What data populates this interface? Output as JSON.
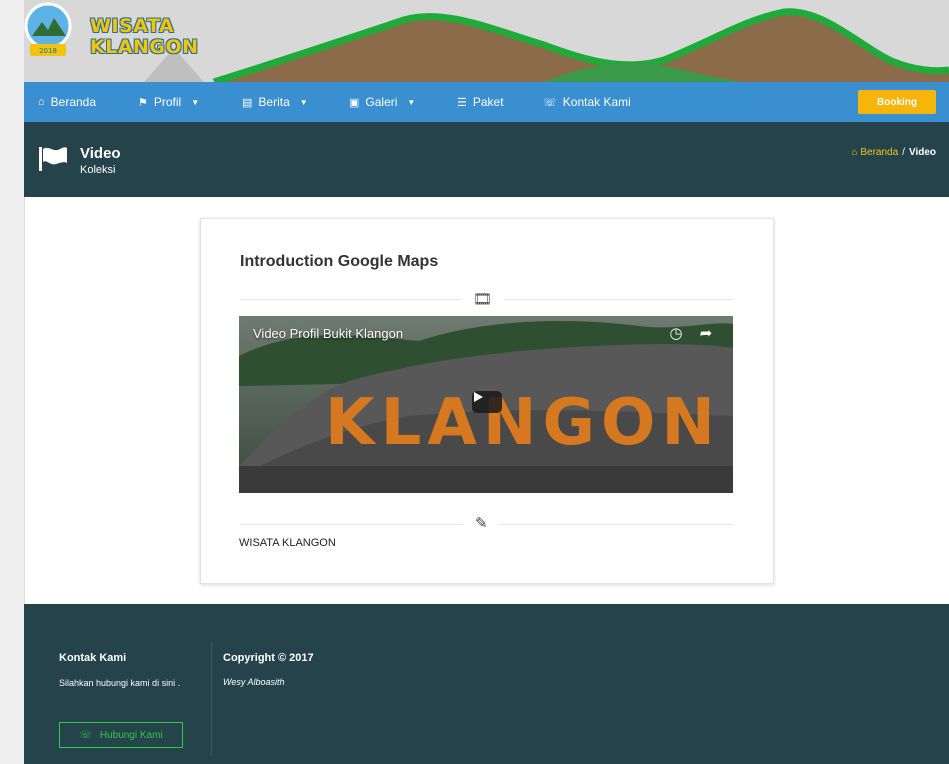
{
  "logo": {
    "line1": "WISATA",
    "line2": "KLANGON"
  },
  "nav": {
    "items": [
      {
        "label": "Beranda",
        "icon": "home-icon",
        "dropdown": false
      },
      {
        "label": "Profil",
        "icon": "flag-icon",
        "dropdown": true
      },
      {
        "label": "Berita",
        "icon": "newspaper-icon",
        "dropdown": true
      },
      {
        "label": "Galeri",
        "icon": "image-icon",
        "dropdown": true
      },
      {
        "label": "Paket",
        "icon": "list-icon",
        "dropdown": false
      },
      {
        "label": "Kontak Kami",
        "icon": "phone-icon",
        "dropdown": false
      }
    ],
    "booking_label": "Booking"
  },
  "page_header": {
    "title": "Video",
    "subtitle": "Koleksi",
    "breadcrumb": {
      "home": "Beranda",
      "separator": "/",
      "current": "Video"
    }
  },
  "content": {
    "title": "Introduction Google Maps",
    "video": {
      "title": "Video Profil Bukit Klangon",
      "sign_text": "KLANGON"
    },
    "caption": "WISATA KLANGON"
  },
  "footer": {
    "contact_heading": "Kontak Kami",
    "contact_text": "Silahkan hubungi kami di sini .",
    "contact_button": "Hubungi Kami",
    "copyright": "Copyright © 2017",
    "author": "Wesy Alboasith"
  },
  "colors": {
    "navbar": "#3a8fd0",
    "dark_panel": "#24434a",
    "booking": "#f5b50a",
    "footer_button": "#2ecc40",
    "breadcrumb_home": "#f5c518"
  }
}
